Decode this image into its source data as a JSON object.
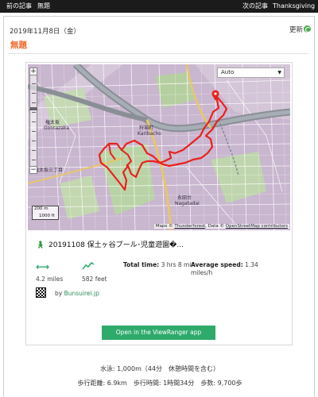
{
  "topbar": {
    "prev_label": "前の記事",
    "current_label": "無題",
    "next_label": "次の記事",
    "next_title": "Thanksgiving"
  },
  "post": {
    "date": "2019年11月8日（金）",
    "update_label": "更新",
    "title": "無題"
  },
  "map": {
    "layer_select_value": "Auto",
    "scale_label_1": "200 m",
    "scale_label_2": "1000 ft",
    "attribution_prefix": "Maps © ",
    "attribution_link1": "Thunderforest",
    "attribution_mid": ", Data © ",
    "attribution_link2": "OpenStreetMap contributors",
    "labels": {
      "karibacho": "Karibacho",
      "karibacho_jp": "狩場町",
      "gontazaka": "Gontazaka",
      "gontazaka_jp": "権太坂",
      "nagatadai": "Nagatadai",
      "nagatadai_jp": "永田台",
      "gontazaka3": "権太坂三丁目"
    }
  },
  "route": {
    "name": "20191108 保土ヶ谷プール･児童遊園�...",
    "distance": "4.2 miles",
    "elevation": "582 feet",
    "total_time_label": "Total time:",
    "total_time_value": "3 hrs 8 min",
    "avg_speed_label": "Average speed:",
    "avg_speed_value": "1.34 miles/h",
    "by_label": "by",
    "author": "Bunsuirei.jp",
    "open_button": "Open in the ViewRanger app"
  },
  "footer": {
    "line1": "水泳: 1,000m（44分　休憩時間を含む）",
    "line2": "歩行距離: 6.9km　歩行時間: 1時間34分　歩数: 9,700歩"
  },
  "colors": {
    "accent_orange": "#ef6c2b",
    "accent_green": "#2eaa6b",
    "route_red": "#e8211c",
    "topbar_bg": "#1b1b1b"
  }
}
